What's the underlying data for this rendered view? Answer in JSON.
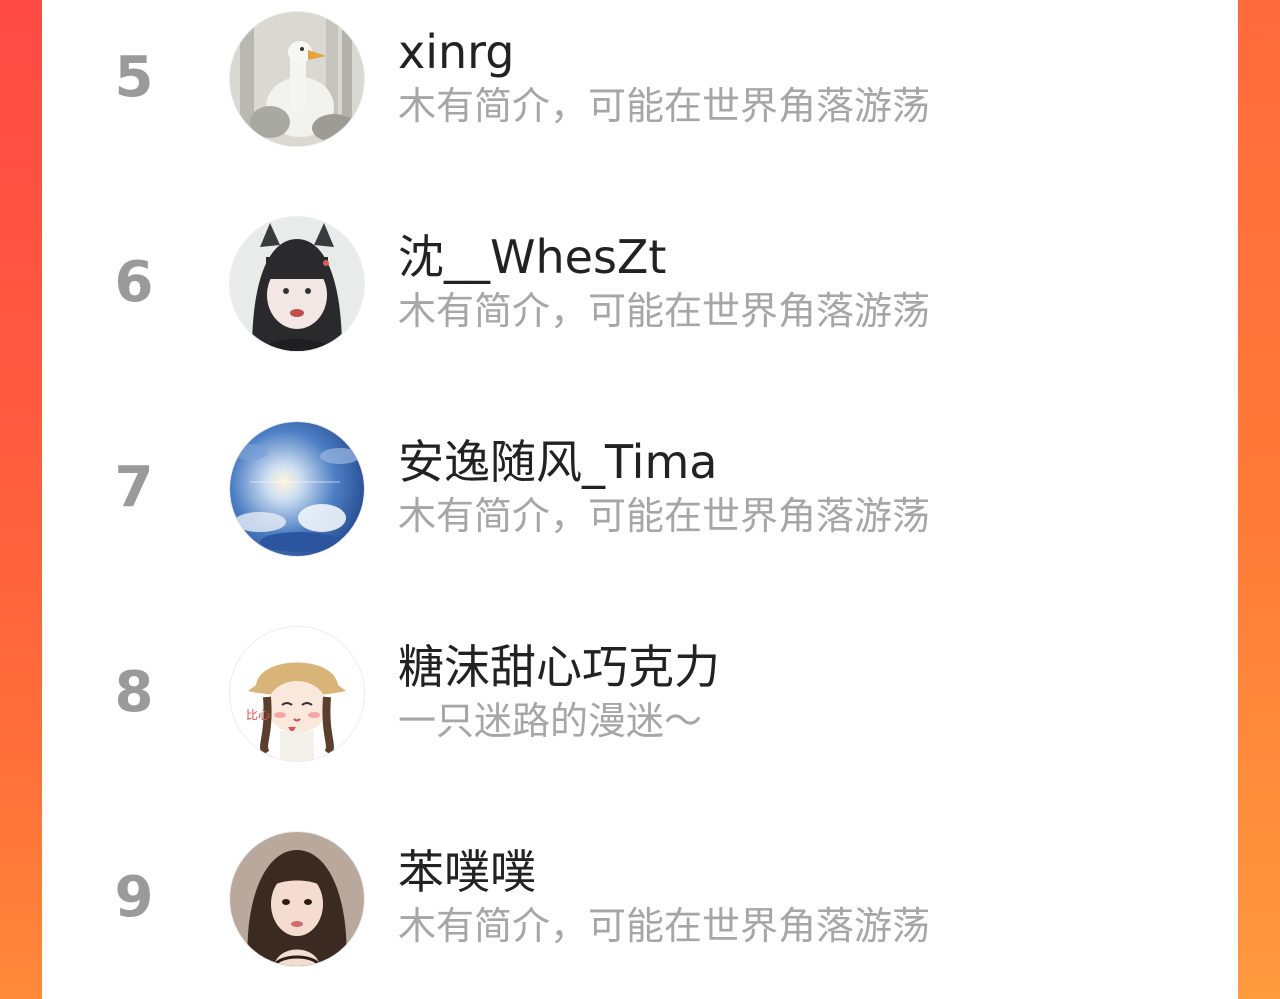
{
  "colors": {
    "accent_gradient_top": "#ff4a45",
    "accent_gradient_bottom": "#ff8a3a",
    "rank_gray": "#9a9a9a",
    "name_text": "#222222",
    "desc_text": "#a6a6a6"
  },
  "list": {
    "items": [
      {
        "rank": "5",
        "name": "xinrg",
        "desc": "木有简介，可能在世界角落游荡",
        "avatar": "goose-photo-avatar"
      },
      {
        "rank": "6",
        "name": "沈__WhesZt",
        "desc": "木有简介，可能在世界角落游荡",
        "avatar": "girl-with-headband-avatar"
      },
      {
        "rank": "7",
        "name": "安逸随风_Tima",
        "desc": "木有简介，可能在世界角落游荡",
        "avatar": "blue-sky-painting-avatar"
      },
      {
        "rank": "8",
        "name": "糖沫甜心巧克力",
        "desc": "一只迷路的漫迷～",
        "avatar": "cartoon-girl-bucket-hat-avatar"
      },
      {
        "rank": "9",
        "name": "苯噗噗",
        "desc": "木有简介，可能在世界角落游荡",
        "avatar": "girl-portrait-avatar"
      }
    ]
  }
}
